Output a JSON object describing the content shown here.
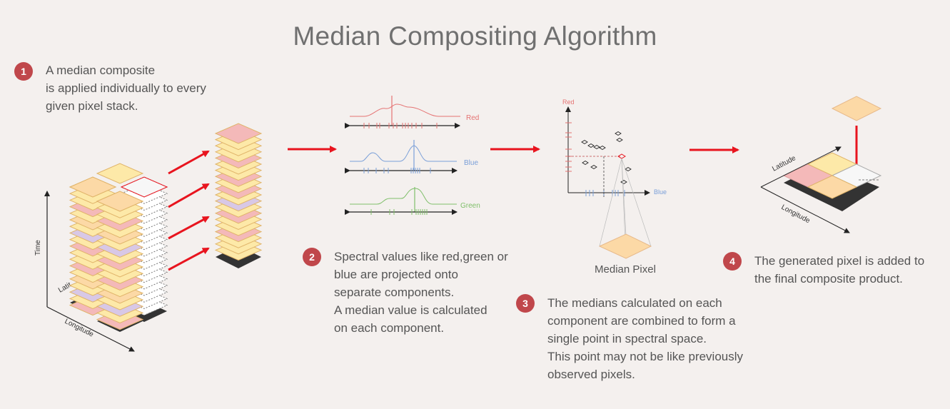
{
  "title": "Median Compositing Algorithm",
  "steps": [
    {
      "number": "1",
      "lines": [
        "A median composite",
        "is applied individually to every",
        "given pixel stack."
      ]
    },
    {
      "number": "2",
      "lines": [
        "Spectral values like red,green or",
        "blue are projected onto",
        "separate components.",
        "A median value is calculated",
        "on each component."
      ]
    },
    {
      "number": "3",
      "lines": [
        "The medians calculated on each",
        "component are combined to form a",
        "single point in spectral space.",
        "This point may not be like previously",
        "observed pixels."
      ]
    },
    {
      "number": "4",
      "lines": [
        "The generated pixel is added to",
        "the final composite product."
      ]
    }
  ],
  "axes": {
    "time": "Time",
    "latitude_partial": "Latit",
    "longitude": "Longitude",
    "latitude": "Latitude"
  },
  "bands": {
    "red": "Red",
    "blue": "Blue",
    "green": "Green"
  },
  "median_pixel_label": "Median Pixel",
  "colors": {
    "badge": "#c0474b",
    "arrow": "#e8141e",
    "red_band": "#e57373",
    "blue_band": "#7a9fd8",
    "green_band": "#7fbf6a",
    "tile_yellow": "#fde9a8",
    "tile_orange": "#fcd9a6",
    "tile_pink": "#f4b9b9",
    "tile_lavender": "#d8c8e6"
  }
}
